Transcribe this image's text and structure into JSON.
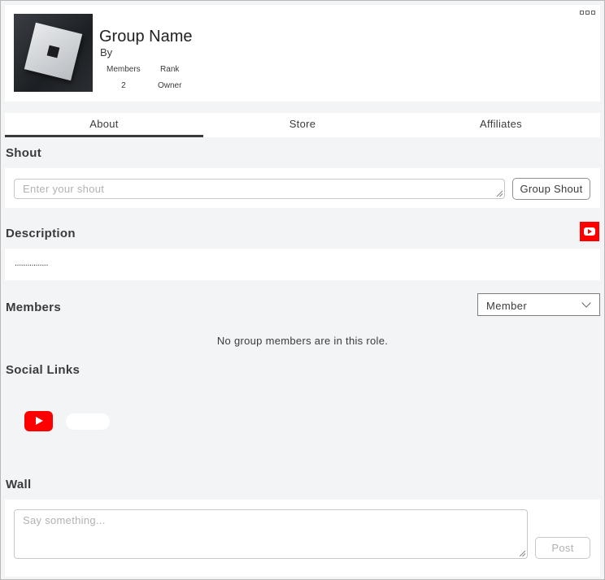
{
  "header": {
    "group_name": "Group Name",
    "by_label": "By",
    "stats": [
      {
        "label": "Members",
        "value": "2"
      },
      {
        "label": "Rank",
        "value": "Owner"
      }
    ],
    "more_icon": "more-dots-icon"
  },
  "tabs": [
    {
      "label": "About",
      "active": true
    },
    {
      "label": "Store",
      "active": false
    },
    {
      "label": "Affiliates",
      "active": false
    }
  ],
  "shout": {
    "title": "Shout",
    "placeholder": "Enter your shout",
    "button_label": "Group Shout"
  },
  "description": {
    "title": "Description",
    "text": "................",
    "social_icon": "youtube-icon"
  },
  "members": {
    "title": "Members",
    "role_selected": "Member",
    "empty_message": "No group members are in this role."
  },
  "social_links": {
    "title": "Social Links",
    "items": [
      {
        "icon": "youtube-icon",
        "label": ""
      }
    ]
  },
  "wall": {
    "title": "Wall",
    "placeholder": "Say something...",
    "button_label": "Post"
  },
  "colors": {
    "background": "#f2f4f5",
    "card": "#ffffff",
    "text": "#393b3d",
    "youtube_red": "#ff0000"
  }
}
